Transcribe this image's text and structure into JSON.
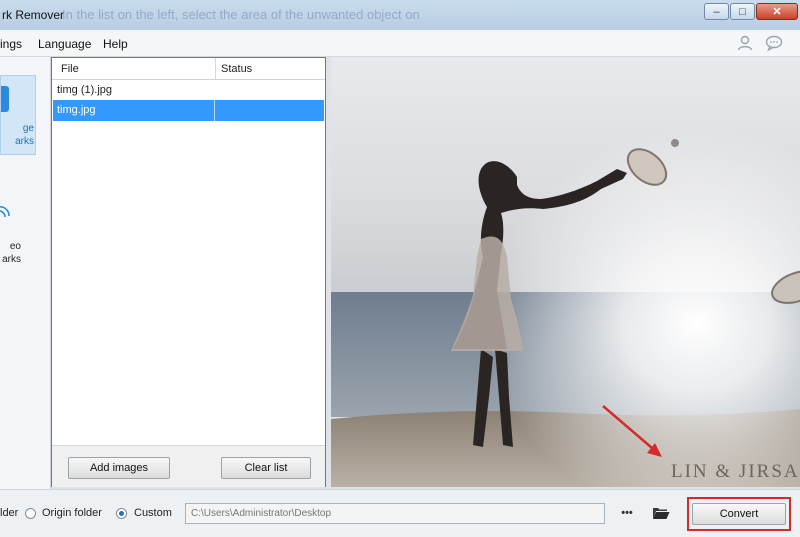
{
  "window": {
    "title": "rk Remover",
    "hint": "In the list on the left, select the area of the unwanted object on",
    "controls": {
      "minimize": "–",
      "maximize": "□",
      "close": "✕"
    }
  },
  "menu": {
    "items": [
      "ings",
      "Language",
      "Help"
    ],
    "icons": [
      "user-icon",
      "chat-icon"
    ]
  },
  "modes": [
    {
      "label_line1": "ge",
      "label_line2": "arks",
      "icon": "image-icon",
      "active": true
    },
    {
      "label_line1": "eo",
      "label_line2": "arks",
      "icon": "video-icon",
      "active": false
    }
  ],
  "file_list": {
    "columns": [
      "File",
      "Status"
    ],
    "rows": [
      {
        "file": "timg (1).jpg",
        "status": "",
        "selected": false
      },
      {
        "file": "timg.jpg",
        "status": "",
        "selected": true
      }
    ],
    "add_button": "Add images",
    "clear_button": "Clear list"
  },
  "preview": {
    "watermark": "LIN & JIRSA"
  },
  "output": {
    "folder_label": "lder",
    "origin_label": "Origin folder",
    "custom_label": "Custom",
    "selected": "custom",
    "path": "C:\\Users\\Administrator\\Desktop",
    "browse_label": "•••",
    "folder_icon": "folder-open-icon",
    "convert_button": "Convert"
  },
  "colors": {
    "selection": "#3399ff",
    "highlight": "#d42a2a",
    "accent": "#1c6fbf"
  }
}
